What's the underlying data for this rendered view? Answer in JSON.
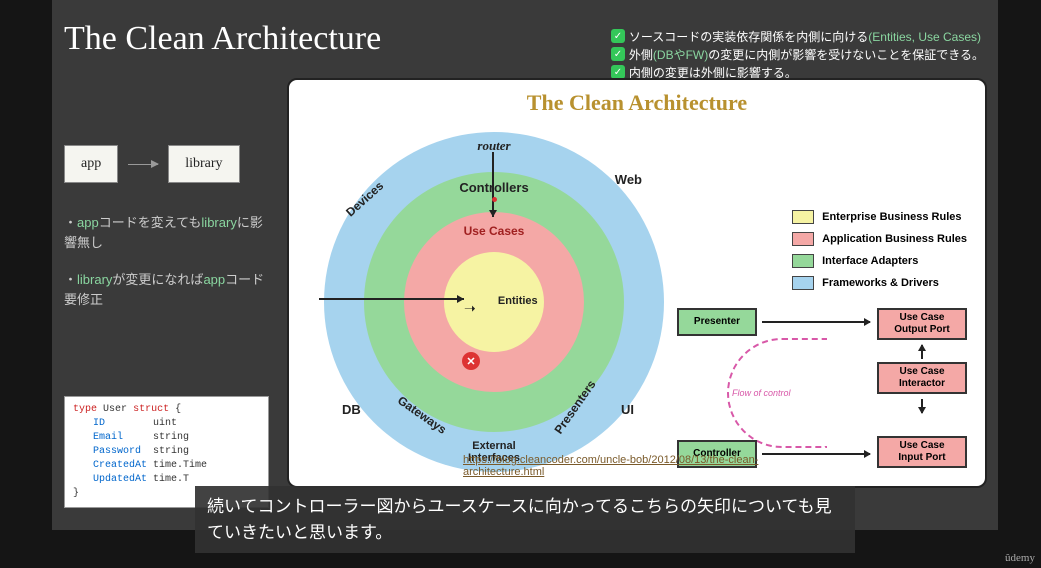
{
  "title": "The Clean Architecture",
  "checks": [
    {
      "prefix": "ソースコードの実装依存関係を内側に向ける",
      "accent": "(Entities, Use Cases)"
    },
    {
      "prefix": "外側",
      "accent": "(DBやFW)",
      "suffix": "の変更に内側が影響を受けないことを保証できる。"
    },
    {
      "prefix": "内側の変更は外側に影響する。"
    }
  ],
  "dep": {
    "left": "app",
    "right": "library"
  },
  "bullets": [
    {
      "pre": "・",
      "hl1": "app",
      "mid1": "コードを変えても",
      "hl2": "library",
      "mid2": "に影響無し"
    },
    {
      "pre": "・",
      "hl1": "library",
      "mid1": "が変更になれば",
      "hl2": "app",
      "mid2": "コード要修正"
    }
  ],
  "code": {
    "l1a": "type",
    "l1b": "User",
    "l1c": "struct",
    "l1d": "{",
    "rows": [
      {
        "f": "ID",
        "t": "uint"
      },
      {
        "f": "Email",
        "t": "string"
      },
      {
        "f": "Password",
        "t": "string"
      },
      {
        "f": "CreatedAt",
        "t": "time.Time"
      },
      {
        "f": "UpdatedAt",
        "t": "time.T"
      }
    ],
    "close": "}"
  },
  "diagram": {
    "title": "The Clean Architecture",
    "labels": {
      "router": "router",
      "controllers": "Controllers",
      "usecases": "Use Cases",
      "entities": "Entities",
      "web": "Web",
      "ui": "UI",
      "db": "DB",
      "devices": "Devices",
      "ext": "External\nInterfaces",
      "gateways": "Gateways",
      "presenters": "Presenters"
    },
    "legend": [
      {
        "sw": "sw-y",
        "label": "Enterprise Business Rules"
      },
      {
        "sw": "sw-p",
        "label": "Application Business Rules"
      },
      {
        "sw": "sw-g",
        "label": "Interface Adapters"
      },
      {
        "sw": "sw-b",
        "label": "Frameworks & Drivers"
      }
    ],
    "flow": {
      "presenter": "Presenter",
      "controller": "Controller",
      "output": "Use Case\nOutput Port",
      "interactor": "Use Case\nInteractor",
      "input": "Use Case\nInput Port",
      "flowlabel": "Flow of control"
    },
    "url": "https://blog.cleancoder.com/uncle-bob/2012/08/13/the-clean-architecture.html"
  },
  "subtitle": "続いてコントローラー図からユースケースに向かってるこちらの矢印についても見ていきたいと思います。",
  "brand": "ûdemy"
}
